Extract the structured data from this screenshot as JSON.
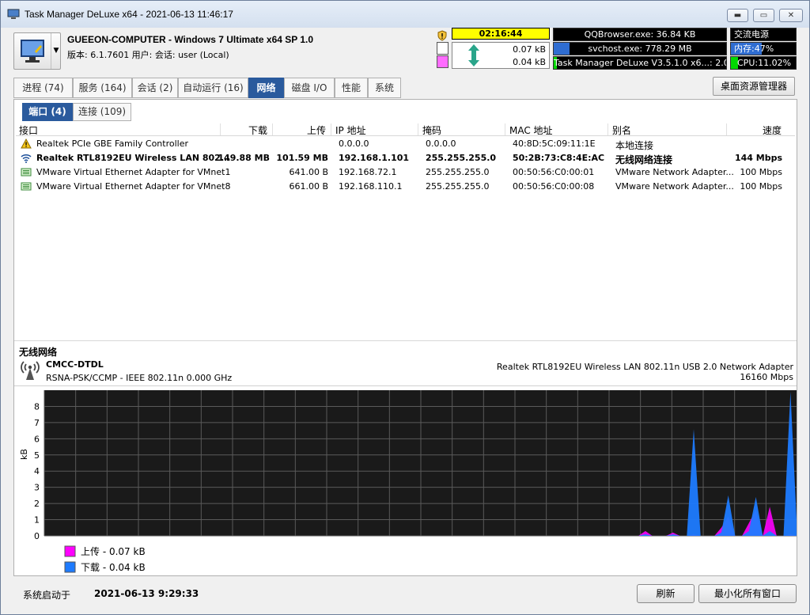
{
  "window": {
    "title": "Task Manager DeLuxe x64 - 2021-06-13 11:46:17",
    "min_symbol": "▬",
    "max_symbol": "▭",
    "close_symbol": "✕"
  },
  "header": {
    "computer_name": "GUEEON-COMPUTER - Windows 7 Ultimate x64 SP 1.0",
    "version_line": "版本: 6.1.7601   用户: 会话: user (Local)",
    "uptime_clock": "02:16:44",
    "net_up": "0.07 kB",
    "net_down": "0.04 kB",
    "top_processes": [
      {
        "text": "QQBrowser.exe: 36.84 KB",
        "fill_fraction": 0.0
      },
      {
        "text": "svchost.exe: 778.29 MB",
        "fill_fraction": 0.09
      },
      {
        "text": "Task Manager DeLuxe V3.5.1.0 x6...: 2.07%",
        "fill_fraction": 0.02
      }
    ],
    "power": "交流电源",
    "memory": {
      "label": "内存:",
      "value": "47%",
      "fraction": 0.47
    },
    "cpu": {
      "label": "CPU:",
      "value": "11.02%",
      "fraction": 0.11
    },
    "colors": {
      "clock_bg": "#ffff00",
      "upload_swatch": "#ff6cff",
      "download_swatch": "#ffffff",
      "mem_fill": "#2f6dd1",
      "cpu_fill": "#00d800"
    }
  },
  "tabs": [
    {
      "label": "进程 (74)"
    },
    {
      "label": "服务 (164)"
    },
    {
      "label": "会话 (2)"
    },
    {
      "label": "自动运行 (16)"
    },
    {
      "label": "网络",
      "active": true
    },
    {
      "label": "磁盘 I/O"
    },
    {
      "label": "性能"
    },
    {
      "label": "系统"
    }
  ],
  "desktop_button": "桌面资源管理器",
  "subtabs": [
    {
      "label": "端口 (4)",
      "active": true
    },
    {
      "label": "连接 (109)"
    }
  ],
  "table": {
    "columns": [
      "接口",
      "下载",
      "上传",
      "IP 地址",
      "掩码",
      "MAC 地址",
      "别名",
      "速度"
    ],
    "rows": [
      {
        "icon": "warning-icon",
        "bold": false,
        "cells": [
          "Realtek PCIe GBE Family Controller",
          "",
          "",
          "0.0.0.0",
          "0.0.0.0",
          "40:8D:5C:09:11:1E",
          "本地连接",
          ""
        ]
      },
      {
        "icon": "wifi-icon",
        "bold": true,
        "cells": [
          "Realtek RTL8192EU Wireless LAN 802...",
          "149.88 MB",
          "101.59 MB",
          "192.168.1.101",
          "255.255.255.0",
          "50:2B:73:C8:4E:AC",
          "无线网络连接",
          "144 Mbps"
        ]
      },
      {
        "icon": "ethernet-icon",
        "bold": false,
        "cells": [
          "VMware Virtual Ethernet Adapter for VMnet1",
          "",
          "641.00 B",
          "192.168.72.1",
          "255.255.255.0",
          "00:50:56:C0:00:01",
          "VMware Network Adapter...",
          "100 Mbps"
        ]
      },
      {
        "icon": "ethernet-icon",
        "bold": false,
        "cells": [
          "VMware Virtual Ethernet Adapter for VMnet8",
          "",
          "661.00 B",
          "192.168.110.1",
          "255.255.255.0",
          "00:50:56:C0:00:08",
          "VMware Network Adapter...",
          "100 Mbps"
        ]
      }
    ]
  },
  "detail": {
    "title": "无线网络",
    "ssid": "CMCC-DTDL",
    "security": "RSNA-PSK/CCMP - IEEE 802.11n 0.000 GHz",
    "adapter": "Realtek RTL8192EU Wireless LAN 802.11n USB 2.0 Network Adapter",
    "speed": "16160 Mbps"
  },
  "chart_data": {
    "type": "area",
    "ylabel": "kB",
    "ylim": [
      0,
      9
    ],
    "yticks": [
      0,
      1,
      2,
      3,
      4,
      5,
      6,
      7,
      8
    ],
    "grid": true,
    "series": [
      {
        "name": "上传 - 0.07 kB",
        "color": "#ff00ff",
        "values": [
          0,
          0,
          0,
          0,
          0,
          0,
          0,
          0,
          0,
          0,
          0,
          0,
          0,
          0,
          0,
          0,
          0,
          0,
          0,
          0,
          0,
          0,
          0,
          0,
          0,
          0,
          0,
          0,
          0,
          0,
          0,
          0,
          0,
          0,
          0,
          0,
          0,
          0,
          0,
          0,
          0,
          0,
          0,
          0,
          0,
          0,
          0,
          0,
          0,
          0,
          0,
          0,
          0,
          0,
          0,
          0,
          0,
          0,
          0,
          0,
          0,
          0,
          0,
          0,
          0,
          0,
          0,
          0,
          0,
          0,
          0,
          0,
          0,
          0,
          0,
          0,
          0,
          0,
          0,
          0,
          0,
          0,
          0,
          0,
          0,
          0,
          0,
          0.3,
          0,
          0,
          0,
          0.2,
          0,
          0,
          0.1,
          0,
          0,
          0,
          0.5,
          1.2,
          0,
          0,
          0.8,
          1.6,
          0,
          1.8,
          0,
          0,
          0.1,
          0
        ]
      },
      {
        "name": "下载 - 0.04 kB",
        "color": "#1e7bff",
        "values": [
          0,
          0,
          0,
          0,
          0,
          0,
          0,
          0,
          0,
          0,
          0,
          0,
          0,
          0,
          0,
          0,
          0,
          0,
          0,
          0,
          0,
          0,
          0,
          0,
          0,
          0,
          0,
          0,
          0,
          0,
          0,
          0,
          0,
          0,
          0,
          0,
          0,
          0,
          0,
          0,
          0,
          0,
          0,
          0,
          0,
          0,
          0,
          0,
          0,
          0,
          0,
          0,
          0,
          0,
          0,
          0,
          0,
          0,
          0,
          0,
          0,
          0,
          0,
          0,
          0,
          0,
          0,
          0,
          0,
          0,
          0,
          0,
          0,
          0,
          0,
          0,
          0,
          0,
          0,
          0,
          0,
          0,
          0,
          0,
          0,
          0,
          0,
          0.1,
          0,
          0,
          0,
          0.1,
          0,
          0,
          6.6,
          0,
          0,
          0,
          0.2,
          2.5,
          0,
          0,
          0.3,
          2.4,
          0,
          0.3,
          0,
          0,
          8.9,
          0
        ]
      }
    ]
  },
  "footer": {
    "boot_label": "系统启动于",
    "boot_time": "2021-06-13 9:29:33",
    "refresh": "刷新",
    "minimize_all": "最小化所有窗口"
  }
}
